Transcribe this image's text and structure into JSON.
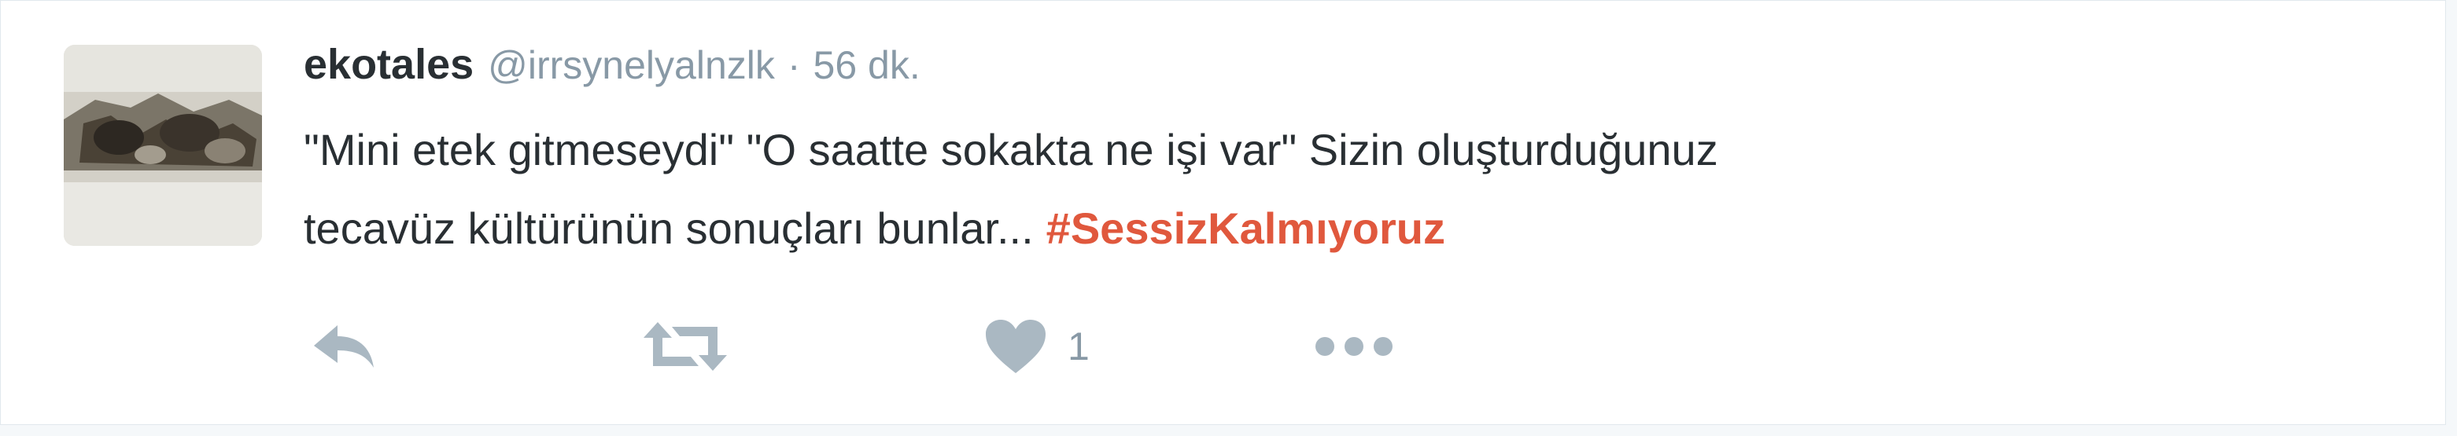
{
  "tweet": {
    "fullname": "ekotales",
    "username": "@irrsynelyalnzlk",
    "separator": "·",
    "time": "56 dk.",
    "text_line1": "\"Mini etek gitmeseydi\" \"O saatte sokakta ne işi var\" Sizin oluşturduğunuz",
    "text_line2": "tecavüz kültürünün sonuçları bunlar...",
    "hashtag": "#SessizKalmıyoruz",
    "like_count": "1"
  },
  "icons": {
    "reply": "reply-icon",
    "retweet": "retweet-icon",
    "like": "heart-icon",
    "more": "more-dots-icon"
  },
  "colors": {
    "name": "#292f33",
    "meta": "#8899a6",
    "hashtag": "#e0583d",
    "icon": "#aab8c2"
  }
}
